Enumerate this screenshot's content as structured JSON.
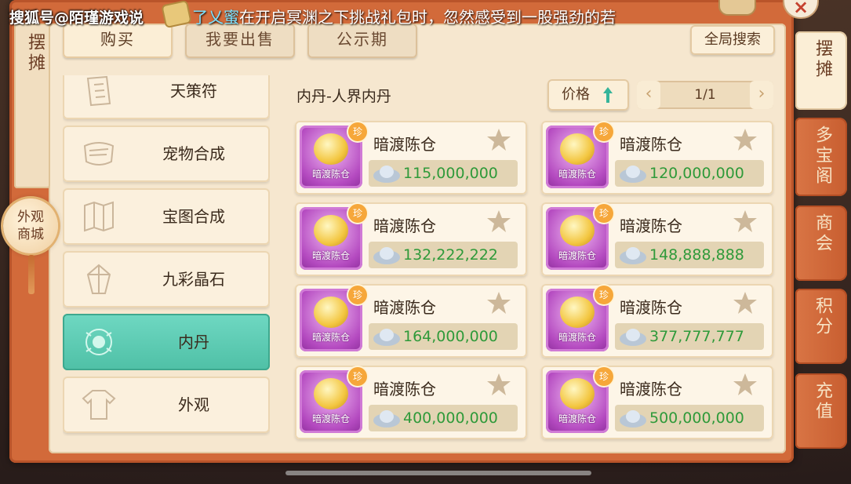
{
  "watermark": "搜狐号@陌瑾游戏说",
  "ticker": {
    "name": "了乂蜜",
    "message": "在开启冥渊之下挑战礼包时，忽然感受到一股强劲的若"
  },
  "close_label": "×",
  "left_panel_title": "摆摊",
  "store_badge": "外观商城",
  "tabs": [
    "购买",
    "我要出售",
    "公示期"
  ],
  "global_search": "全局搜索",
  "categories": [
    {
      "label": "天策符",
      "icon": "talisman-icon"
    },
    {
      "label": "宠物合成",
      "icon": "scroll-icon"
    },
    {
      "label": "宝图合成",
      "icon": "map-icon"
    },
    {
      "label": "九彩晶石",
      "icon": "crystal-icon"
    },
    {
      "label": "内丹",
      "icon": "inner-core-icon",
      "active": true
    },
    {
      "label": "外观",
      "icon": "robe-icon"
    }
  ],
  "section_title": "内丹-人界内丹",
  "sort": {
    "label": "价格",
    "direction": "ascending"
  },
  "pager": {
    "prev": "‹",
    "text": "1/1",
    "next": "›"
  },
  "rare_badge": "珍",
  "items": [
    {
      "name": "暗渡陈仓",
      "thumb_label": "暗渡陈仓",
      "price": "115,000,000"
    },
    {
      "name": "暗渡陈仓",
      "thumb_label": "暗渡陈仓",
      "price": "120,000,000"
    },
    {
      "name": "暗渡陈仓",
      "thumb_label": "暗渡陈仓",
      "price": "132,222,222"
    },
    {
      "name": "暗渡陈仓",
      "thumb_label": "暗渡陈仓",
      "price": "148,888,888"
    },
    {
      "name": "暗渡陈仓",
      "thumb_label": "暗渡陈仓",
      "price": "164,000,000"
    },
    {
      "name": "暗渡陈仓",
      "thumb_label": "暗渡陈仓",
      "price": "377,777,777"
    },
    {
      "name": "暗渡陈仓",
      "thumb_label": "暗渡陈仓",
      "price": "400,000,000"
    },
    {
      "name": "暗渡陈仓",
      "thumb_label": "暗渡陈仓",
      "price": "500,000,000"
    }
  ],
  "right_tabs": [
    {
      "label": "摆摊",
      "active": true
    },
    {
      "label": "多宝阁"
    },
    {
      "label": "商会"
    },
    {
      "label": "积分"
    },
    {
      "label": "充值"
    }
  ],
  "colors": {
    "frame": "#d26a3a",
    "panel": "#f6e7cf",
    "active_category": "#5ccab0",
    "price_green": "#2f9a3a",
    "item_purple": "#b44ac0"
  }
}
